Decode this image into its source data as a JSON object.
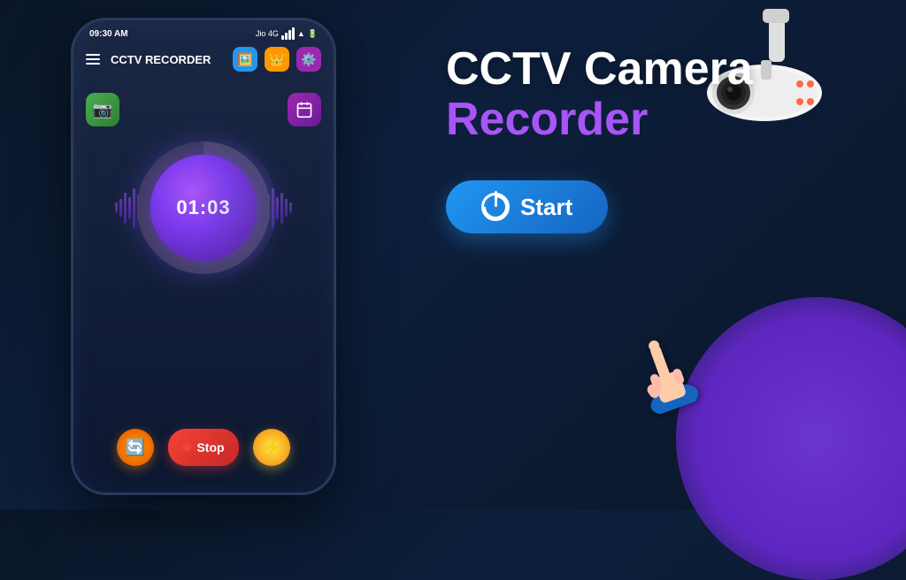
{
  "app": {
    "title": "CCTV Camera Recorder",
    "title_line1": "CCTV Camera",
    "title_line2": "Recorder"
  },
  "status_bar": {
    "time": "09:30 AM",
    "carrier": "Jio 4G"
  },
  "toolbar": {
    "menu_icon": "☰",
    "title": "CCTV RECORDER"
  },
  "timer": {
    "display": "01:03"
  },
  "controls": {
    "stop_label": "Stop",
    "start_label": "Start"
  },
  "phone": {
    "green_btn_icon": "📷",
    "purple_btn_icon": "📅",
    "orange_btn_icon": "🔄",
    "yellow_btn_icon": "⚡"
  }
}
